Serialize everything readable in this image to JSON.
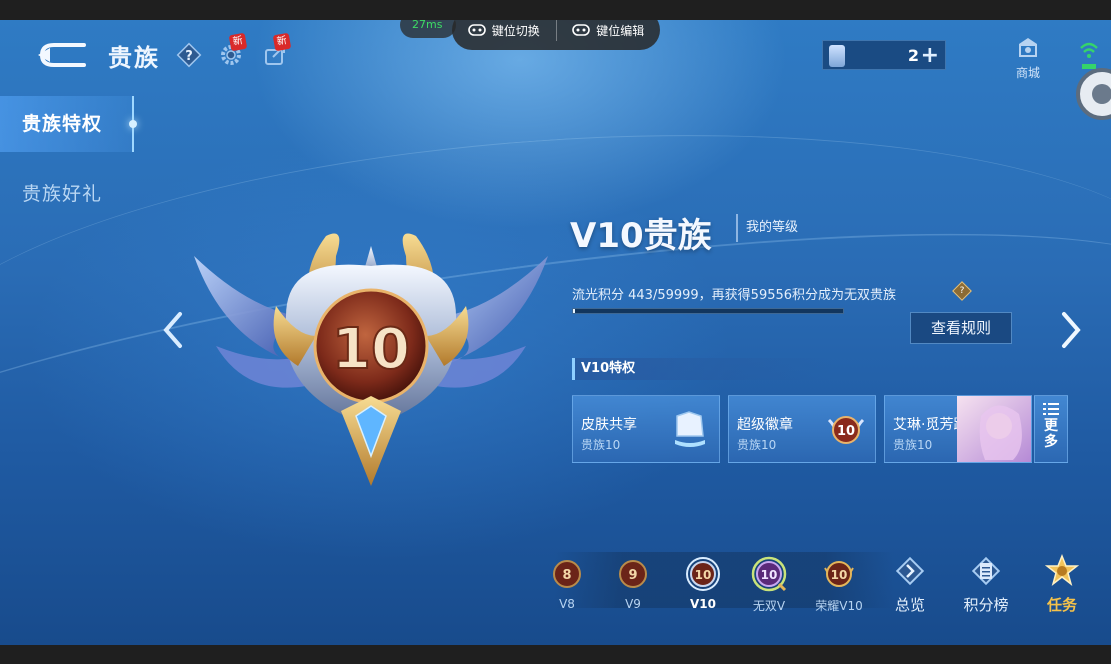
{
  "header": {
    "title": "贵族",
    "help_icon_label": "?",
    "new_badge": "新"
  },
  "overlay": {
    "ping": "27ms",
    "key_switch": "键位切换",
    "key_edit": "键位编辑"
  },
  "currency": {
    "amount": "2",
    "plus": "+"
  },
  "shop": {
    "label": "商城"
  },
  "nav": {
    "items": [
      {
        "label": "贵族特权",
        "active": true
      },
      {
        "label": "贵族好礼",
        "active": false
      }
    ]
  },
  "emblem": {
    "level": "10"
  },
  "info": {
    "vip_title": "V10贵族",
    "my_level": "我的等级",
    "points_text": "流光积分 443/59999，再获得59556积分成为无双贵族",
    "progress": 0.0074,
    "help_mark": "?",
    "rules_button": "查看规则"
  },
  "privileges": {
    "header": "V10特权",
    "cards": [
      {
        "name": "皮肤共享",
        "sub": "贵族10"
      },
      {
        "name": "超级徽章",
        "sub": "贵族10",
        "badge": "10"
      },
      {
        "name": "艾琳·觅芳踪",
        "sub": "贵族10"
      }
    ],
    "more": [
      "更",
      "多"
    ]
  },
  "tiers": [
    {
      "label": "V8",
      "num": "8"
    },
    {
      "label": "V9",
      "num": "9"
    },
    {
      "label": "V10",
      "num": "10",
      "current": true
    },
    {
      "label": "无双V",
      "num": "10"
    },
    {
      "label": "荣耀V10",
      "num": "10"
    }
  ],
  "bottom_buttons": {
    "overview": "总览",
    "leaderboard": "积分榜",
    "task": "任务"
  },
  "colors": {
    "accent": "#9fd8ff",
    "gold": "#e3b55a",
    "badge_red": "#d92a2a",
    "task_gold": "#f5c24a"
  }
}
